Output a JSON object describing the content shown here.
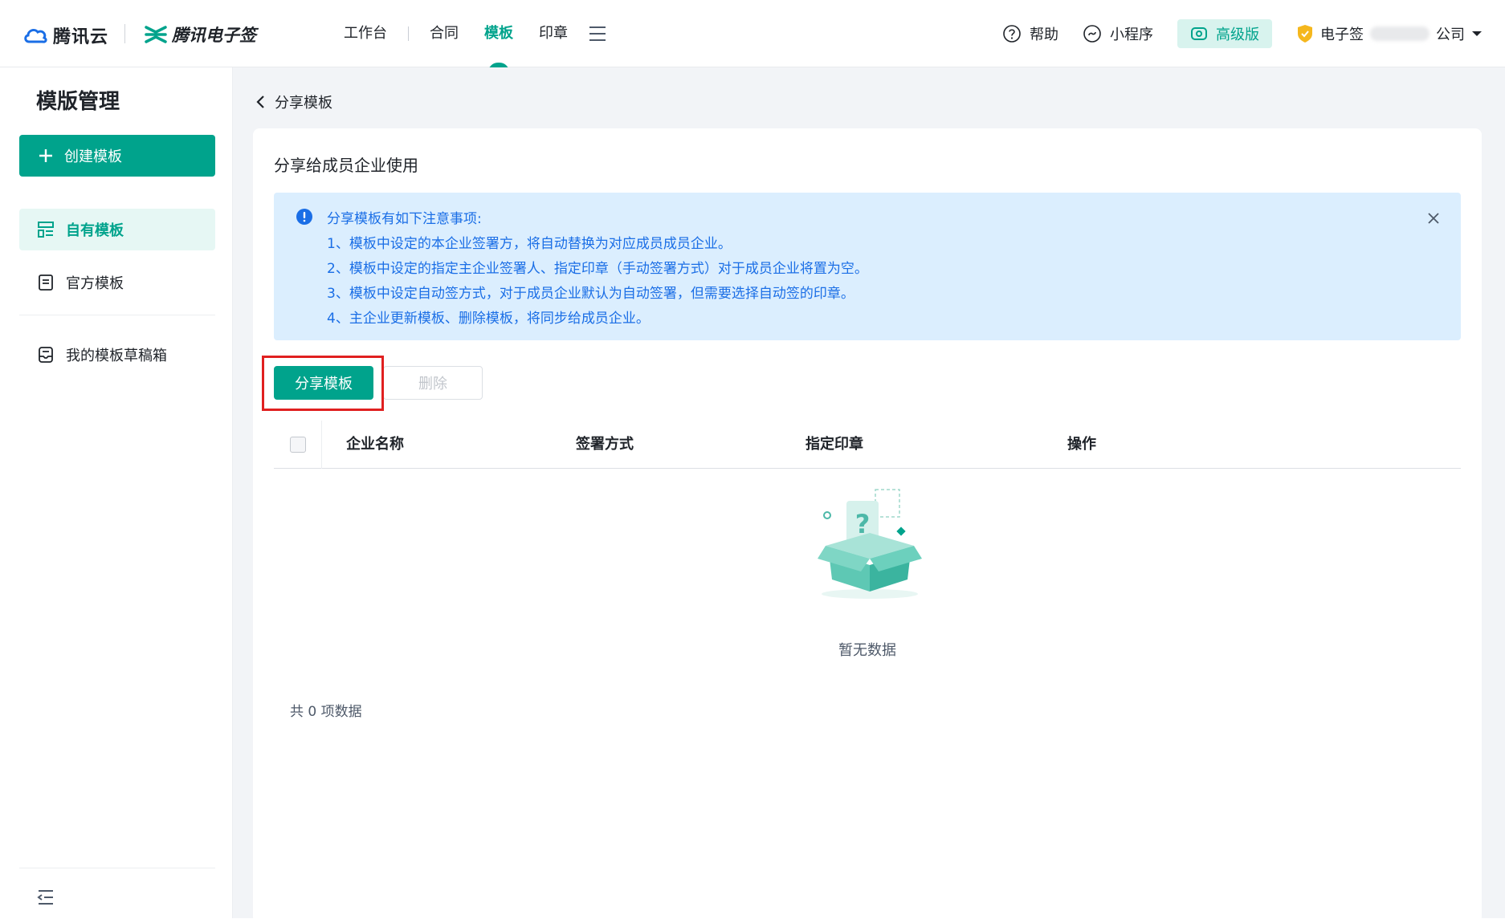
{
  "header": {
    "brand_cloud": "腾讯云",
    "brand_esign": "腾讯电子签",
    "nav": [
      {
        "label": "工作台",
        "active": false
      },
      {
        "label": "合同",
        "active": false
      },
      {
        "label": "模板",
        "active": true
      },
      {
        "label": "印章",
        "active": false
      }
    ],
    "help": "帮助",
    "mini_program": "小程序",
    "premium": "高级版",
    "company_prefix": "电子签",
    "company_suffix": "公司"
  },
  "sidebar": {
    "title": "模版管理",
    "create_label": "创建模板",
    "items": [
      {
        "label": "自有模板",
        "icon": "list-icon",
        "active": true
      },
      {
        "label": "官方模板",
        "icon": "document-icon",
        "active": false
      },
      {
        "label": "我的模板草稿箱",
        "icon": "inbox-icon",
        "active": false
      }
    ]
  },
  "main": {
    "back_label": "分享模板",
    "card_title": "分享给成员企业使用",
    "notice": {
      "title": "分享模板有如下注意事项:",
      "lines": [
        "1、模板中设定的本企业签署方，将自动替换为对应成员成员企业。",
        "2、模板中设定的指定主企业签署人、指定印章（手动签署方式）对于成员企业将置为空。",
        "3、模板中设定自动签方式，对于成员企业默认为自动签署，但需要选择自动签的印章。",
        "4、主企业更新模板、删除模板，将同步给成员企业。"
      ]
    },
    "share_button": "分享模板",
    "delete_button": "删除",
    "table": {
      "columns": [
        "企业名称",
        "签署方式",
        "指定印章",
        "操作"
      ]
    },
    "empty_text": "暂无数据",
    "total_text": "共 0 项数据"
  },
  "colors": {
    "accent": "#00a38c",
    "notice_bg": "#dbeefe",
    "notice_text": "#1a6ee6",
    "highlight": "#e02020"
  }
}
